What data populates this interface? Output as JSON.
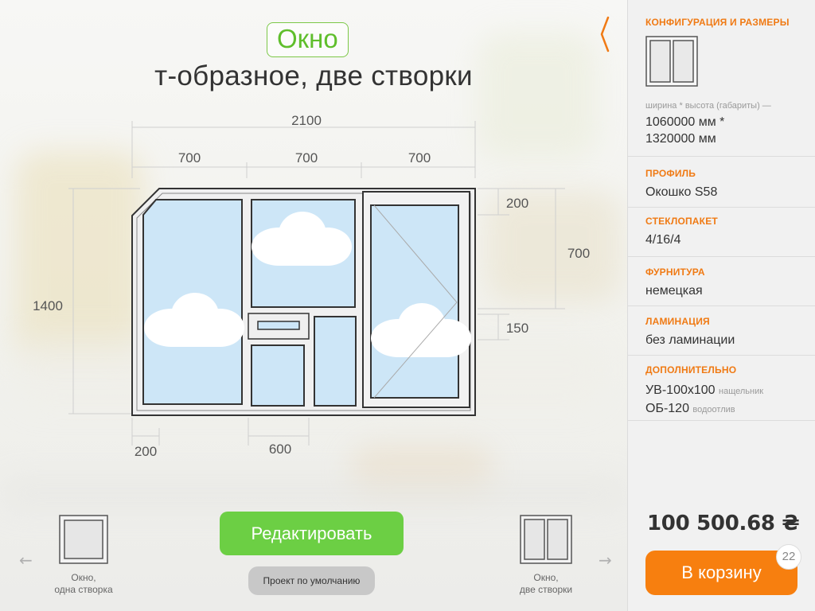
{
  "header": {
    "title": "Окно",
    "subtitle": "т-образное, две створки"
  },
  "dimensions": {
    "total_width": "2100",
    "section_1": "700",
    "section_2": "700",
    "section_3": "700",
    "total_height": "1400",
    "right_top": "200",
    "right_middle": "700",
    "right_bottom": "150",
    "bottom_left": "200",
    "bottom_middle": "600"
  },
  "carousel": {
    "prev_item": {
      "label_line1": "Окно,",
      "label_line2": "одна створка"
    },
    "next_item": {
      "label_line1": "Окно,",
      "label_line2": "две створки"
    },
    "prev_arrow_icon": "arrow-left-icon",
    "next_arrow_icon": "arrow-right-icon"
  },
  "actions": {
    "edit_label": "Редактировать",
    "default_project_label": "Проект по умолчанию"
  },
  "sidebar": {
    "config": {
      "title": "КОНФИГУРАЦИЯ И РАЗМЕРЫ",
      "caption": "ширина * высота (габариты) —",
      "size_line1": "1060000 мм *",
      "size_line2": "1320000 мм"
    },
    "profile": {
      "title": "ПРОФИЛЬ",
      "value": "Окошко S58"
    },
    "glass": {
      "title": "СТЕКЛОПАКЕТ",
      "value": "4/16/4"
    },
    "hardware": {
      "title": "ФУРНИТУРА",
      "value": "немецкая"
    },
    "lamination": {
      "title": "ЛАМИНАЦИЯ",
      "value": "без ламинации"
    },
    "extra": {
      "title": "ДОПОЛНИТЕЛЬНО",
      "item1_value": "УВ-100х100",
      "item1_note": "нащельник",
      "item2_value": "ОБ-120",
      "item2_note": "водоотлив"
    },
    "price": "100 500.68 ₴",
    "cart_label": "В корзину",
    "cart_count": "22"
  },
  "colors": {
    "accent_orange": "#f77f0f",
    "accent_green": "#6ccf44",
    "title_green": "#5fbe2c",
    "glass_blue": "#cde6f7"
  }
}
